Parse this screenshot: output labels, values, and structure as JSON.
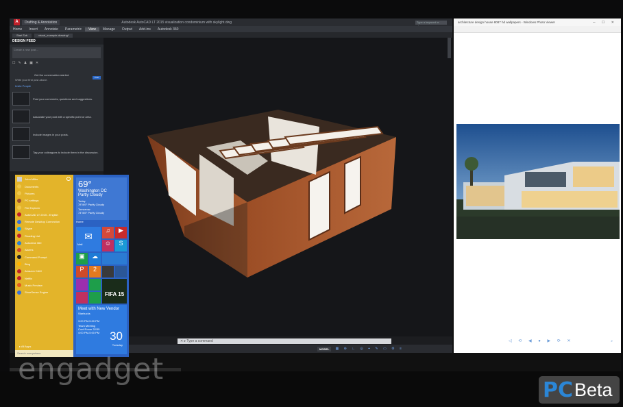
{
  "autocad": {
    "workspace": "Drafting & Annotation",
    "title": "Autodesk AutoCAD LT 2015  visualization  condominium with skylight.dwg",
    "search_placeholder": "Type a keyword or phrase",
    "ribbon_tabs": [
      "Home",
      "Insert",
      "Annotate",
      "Parametric",
      "View",
      "Manage",
      "Output",
      "Add-ins",
      "Autodesk 360"
    ],
    "active_tab": "View",
    "file_tabs": [
      "Start Tab",
      "visual_example-drawing*"
    ],
    "design_feed": {
      "header": "DESIGN FEED",
      "input_placeholder": "Create a new post...",
      "post_button": "Post",
      "message": "Get the conversation started.",
      "sub": "Write your first post above.",
      "link": "Invite People",
      "rows": [
        "Post your comments, questions and suggestions.",
        "Associate your post with a specific point or area.",
        "Include images in your posts.",
        "Tag your colleagues to include them in the discussion."
      ]
    },
    "command_prompt": "Type a command",
    "status": {
      "model": "MODEL"
    }
  },
  "viewer": {
    "title": "architecture design house 8087 hd wallpapers - Windows Photo Viewer"
  },
  "start_menu": {
    "user": "John Miller",
    "apps": [
      {
        "label": "Documents",
        "color": "#f0c84c"
      },
      {
        "label": "Pictures",
        "color": "#f0c84c"
      },
      {
        "label": "PC settings",
        "color": "#a0522d"
      },
      {
        "label": "File Explorer",
        "color": "#f0c84c"
      },
      {
        "label": "AutoCAD LT 2015 - English",
        "color": "#c0202a"
      },
      {
        "label": "Remote Desktop Connection",
        "color": "#3a6fd8"
      },
      {
        "label": "Skype",
        "color": "#1da1f2"
      },
      {
        "label": "Reading List",
        "color": "#c0202a"
      },
      {
        "label": "Autodesk 360",
        "color": "#2a7fd4"
      },
      {
        "label": "Alarms",
        "color": "#d04a2a"
      },
      {
        "label": "Command Prompt",
        "color": "#222222"
      },
      {
        "label": "Bing",
        "color": "#ffb300"
      },
      {
        "label": "Amazon CAM",
        "color": "#c0202a"
      },
      {
        "label": "Netflix",
        "color": "#c0202a"
      },
      {
        "label": "Music Preview",
        "color": "#e35b1e"
      },
      {
        "label": "ShoeSense Engine",
        "color": "#3a6fd8"
      }
    ],
    "all_apps": "All Apps",
    "search_placeholder": "Search everywhere",
    "weather": {
      "temp": "69°",
      "city": "Washington DC",
      "condition": "Partly Cloudy",
      "today": "Today",
      "today_fc": "78°/69° Partly Cloudy",
      "tomorrow": "Tomorrow",
      "tomorrow_fc": "74°/65° Partly Cloudy"
    },
    "home_label": "Home",
    "mail_label": "Mail",
    "game_label": "FIFA 15",
    "calendar": {
      "title": "Meet with New Vendor",
      "location": "Starbucks",
      "time": "3:00 PM-5:00 PM",
      "more": "Team Meeting",
      "more_loc": "Conf Room 32/35",
      "more_time": "4:00 PM-5:00 PM",
      "day": "30",
      "weekday": "Tuesday"
    }
  },
  "watermark": "engadget",
  "brand": {
    "logo": "PC",
    "beta": "Beta"
  }
}
